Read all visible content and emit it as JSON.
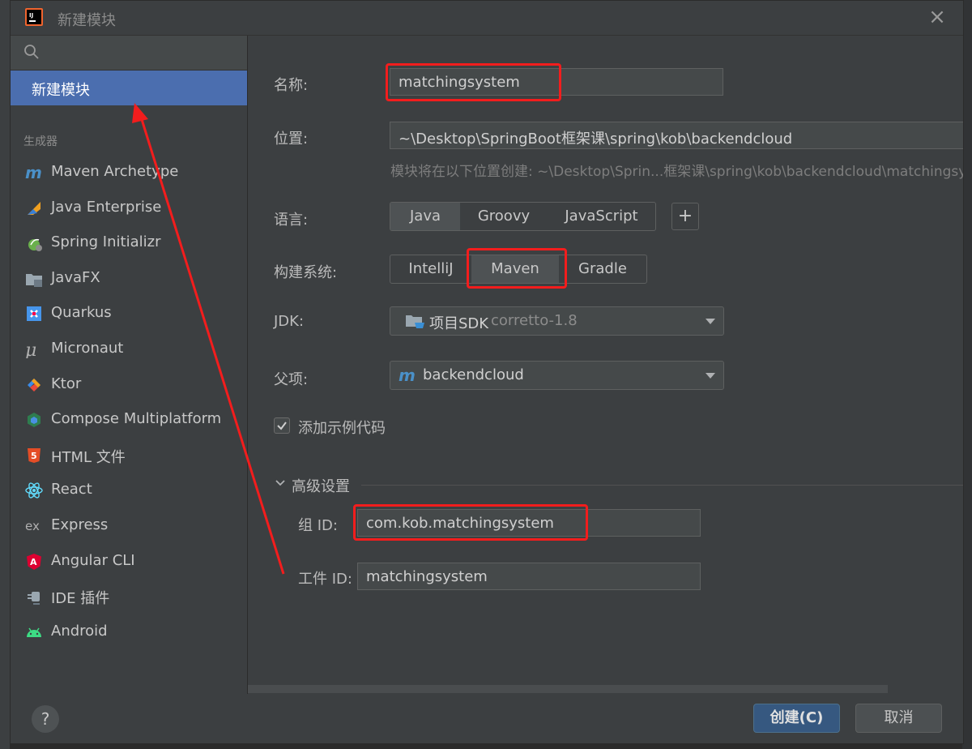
{
  "dialog": {
    "title": "新建模块",
    "close_glyph": "×"
  },
  "sidebar": {
    "search_placeholder": "",
    "selected_item": "新建模块",
    "generators_label": "生成器",
    "generators": [
      {
        "label": "Maven Archetype",
        "icon": "maven-icon"
      },
      {
        "label": "Java Enterprise",
        "icon": "java-enterprise-icon"
      },
      {
        "label": "Spring Initializr",
        "icon": "spring-icon"
      },
      {
        "label": "JavaFX",
        "icon": "javafx-icon"
      },
      {
        "label": "Quarkus",
        "icon": "quarkus-icon"
      },
      {
        "label": "Micronaut",
        "icon": "micronaut-icon"
      },
      {
        "label": "Ktor",
        "icon": "ktor-icon"
      },
      {
        "label": "Compose Multiplatform",
        "icon": "compose-icon"
      },
      {
        "label": "HTML 文件",
        "icon": "html5-icon"
      },
      {
        "label": "React",
        "icon": "react-icon"
      },
      {
        "label": "Express",
        "icon": "express-icon"
      },
      {
        "label": "Angular CLI",
        "icon": "angular-icon"
      },
      {
        "label": "IDE 插件",
        "icon": "plugin-icon"
      },
      {
        "label": "Android",
        "icon": "android-icon"
      }
    ],
    "help_glyph": "?"
  },
  "form": {
    "name_label": "名称:",
    "name_value": "matchingsystem",
    "location_label": "位置:",
    "location_value": "~\\Desktop\\SpringBoot框架课\\spring\\kob\\backendcloud",
    "location_hint": "模块将在以下位置创建: ~\\Desktop\\Sprin...框架课\\spring\\kob\\backendcloud\\matchingsystem",
    "language_label": "语言:",
    "languages": [
      "Java",
      "Groovy",
      "JavaScript"
    ],
    "language_selected": "Java",
    "add_language_glyph": "+",
    "build_label": "构建系统:",
    "build_systems": [
      "IntelliJ",
      "Maven",
      "Gradle"
    ],
    "build_selected": "Maven",
    "jdk_label": "JDK:",
    "jdk_value": "项目SDK",
    "jdk_version": "corretto-1.8",
    "parent_label": "父项:",
    "parent_value": "backendcloud",
    "sample_code_label": "添加示例代码",
    "sample_code_checked": true,
    "advanced_label": "高级设置",
    "group_id_label": "组 ID:",
    "group_id_value": "com.kob.matchingsystem",
    "artifact_id_label": "工件 ID:",
    "artifact_id_value": "matchingsystem"
  },
  "footer": {
    "create_label": "创建(C)",
    "cancel_label": "取消"
  },
  "colors": {
    "dialog_bg": "#3c3f41",
    "selection": "#4b6eaf",
    "primary_button": "#365880",
    "annotation_red": "#f21d1d"
  }
}
